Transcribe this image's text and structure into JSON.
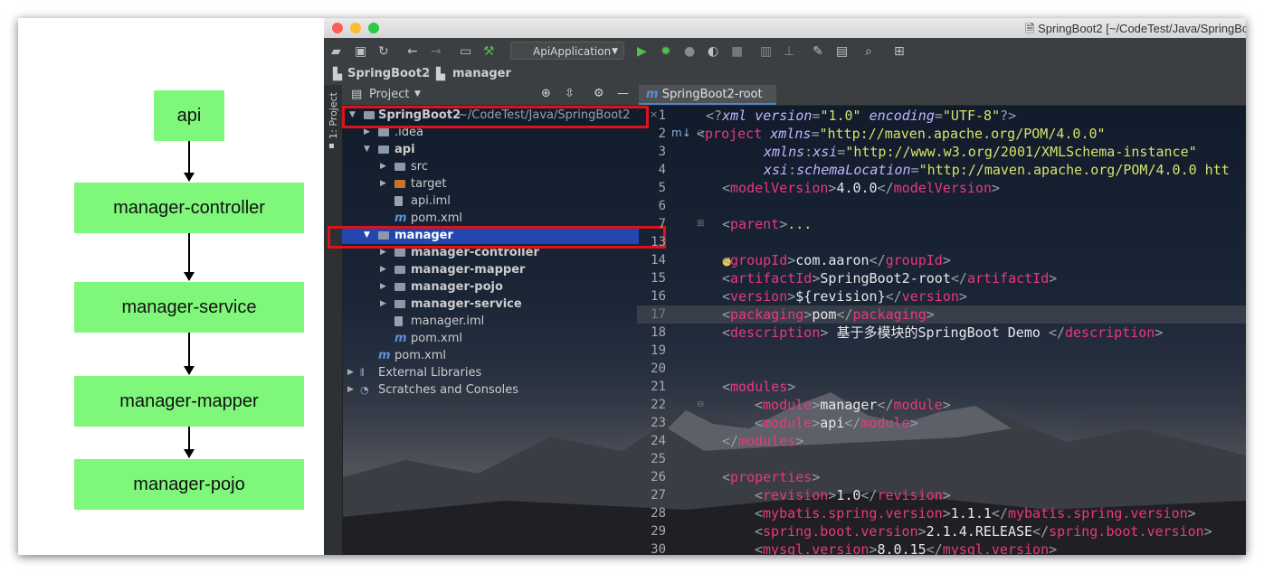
{
  "diagram": {
    "boxes": [
      "api",
      "manager-controller",
      "manager-service",
      "manager-mapper",
      "manager-pojo"
    ],
    "box_color": "#7ff77a"
  },
  "window": {
    "title": "SpringBoot2 [~/CodeTest/Java/SpringBoo"
  },
  "toolbar": {
    "run_config": "ApiApplication"
  },
  "navbar": {
    "crumbs": [
      "SpringBoot2",
      "manager"
    ]
  },
  "sidebar": {
    "tool_label": "1: Project"
  },
  "project_panel": {
    "title": "Project",
    "tree": [
      {
        "label": "SpringBoot2",
        "extra": "~/CodeTest/Java/SpringBoot2"
      },
      {
        "label": ".idea"
      },
      {
        "label": "api"
      },
      {
        "label": "src"
      },
      {
        "label": "target"
      },
      {
        "label": "api.iml"
      },
      {
        "label": "pom.xml"
      },
      {
        "label": "manager"
      },
      {
        "label": "manager-controller"
      },
      {
        "label": "manager-mapper"
      },
      {
        "label": "manager-pojo"
      },
      {
        "label": "manager-service"
      },
      {
        "label": "manager.iml"
      },
      {
        "label": "pom.xml"
      },
      {
        "label": "pom.xml"
      },
      {
        "label": "External Libraries"
      },
      {
        "label": "Scratches and Consoles"
      }
    ],
    "selected": "manager"
  },
  "editor": {
    "tab_label": "SpringBoot2-root",
    "line_numbers": [
      "1",
      "2",
      "3",
      "4",
      "5",
      "6",
      "7",
      "13",
      "14",
      "15",
      "16",
      "17",
      "18",
      "19",
      "20",
      "21",
      "22",
      "23",
      "24",
      "25",
      "26",
      "27",
      "28",
      "29",
      "30"
    ],
    "tokens": {
      "l1": [
        "xml",
        "version",
        "\"1.0\"",
        "encoding",
        "\"UTF-8\""
      ],
      "l2": [
        "project",
        "xmlns",
        "\"http://maven.apache.org/POM/4.0.0\""
      ],
      "l3": [
        "xmlns",
        "xsi",
        "\"http://www.w3.org/2001/XMLSchema-instance\""
      ],
      "l4": [
        "xsi",
        "schemaLocation",
        "\"http://maven.apache.org/POM/4.0.0 htt"
      ],
      "l5": [
        "modelVersion",
        "4.0.0"
      ],
      "l7": [
        "parent",
        "..."
      ],
      "l14": [
        "groupId",
        "com.aaron"
      ],
      "l15": [
        "artifactId",
        "SpringBoot2-root"
      ],
      "l16": [
        "version",
        "${revision}"
      ],
      "l17": [
        "packaging",
        "pom"
      ],
      "l18": [
        "description",
        "基于多模块的SpringBoot Demo"
      ],
      "l21": [
        "modules"
      ],
      "l22": [
        "module",
        "manager"
      ],
      "l23": [
        "module",
        "api"
      ],
      "l24": [
        "modules"
      ],
      "l26": [
        "properties"
      ],
      "l27": [
        "revision",
        "1.0"
      ],
      "l28": [
        "mybatis.spring.version",
        "1.1.1"
      ],
      "l29": [
        "spring.boot.version",
        "2.1.4.RELEASE"
      ],
      "l30": [
        "mysql.version",
        "8.0.15"
      ]
    }
  },
  "colors": {
    "tag": "#e8397f",
    "attribute": "#c2b4ff",
    "string": "#d8e26a",
    "selection": "#2346b1",
    "highlight_box": "#d9141d"
  }
}
